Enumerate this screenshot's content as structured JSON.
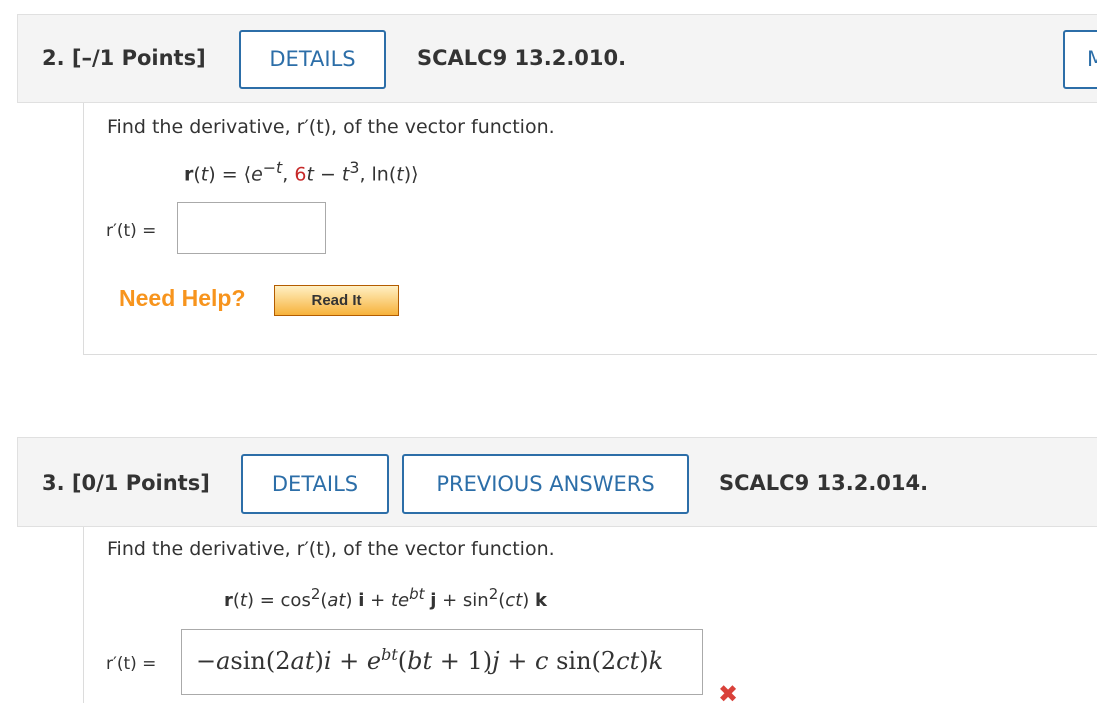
{
  "q2": {
    "number_label": "2.  [–/1 Points]",
    "details_label": "DETAILS",
    "code": "SCALC9 13.2.010.",
    "right_button_fragment": "M",
    "prompt": "Find the derivative, r′(t), of the vector function.",
    "answer_label": "r′(t)  =",
    "answer_value": "",
    "need_help": "Need Help?",
    "read_it": "Read It"
  },
  "q3": {
    "number_label": "3.  [0/1 Points]",
    "details_label": "DETAILS",
    "prev_answers_label": "PREVIOUS ANSWERS",
    "code": "SCALC9 13.2.014.",
    "prompt": "Find the derivative, r′(t), of the vector function.",
    "answer_label": "r′(t)  =",
    "status": "incorrect"
  },
  "colors": {
    "accent": "#2c6ea8",
    "help": "#f7941d",
    "incorrect": "#d9413a",
    "red_term": "#c62828"
  }
}
